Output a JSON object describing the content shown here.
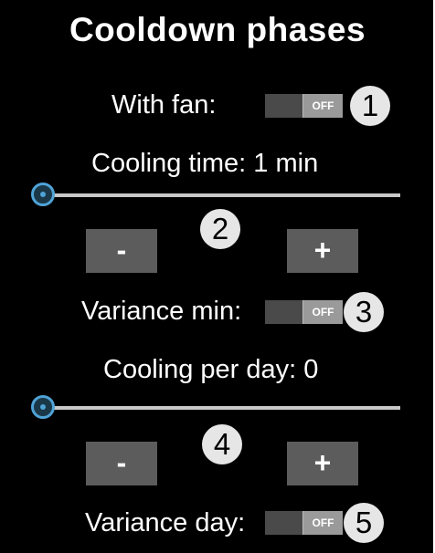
{
  "header": {
    "title": "Cooldown phases"
  },
  "with_fan": {
    "label": "With fan:",
    "toggle_text": "OFF",
    "badge": "1"
  },
  "cooling_time": {
    "label": "Cooling time: 1 min",
    "slider_value": 0,
    "badge": "2",
    "minus_label": "-",
    "plus_label": "+"
  },
  "variance_min": {
    "label": "Variance min:",
    "toggle_text": "OFF",
    "badge": "3"
  },
  "cooling_per_day": {
    "label": "Cooling per day: 0",
    "slider_value": 0,
    "badge": "4",
    "minus_label": "-",
    "plus_label": "+"
  },
  "variance_day": {
    "label": "Variance day:",
    "toggle_text": "OFF",
    "badge": "5"
  },
  "colors": {
    "background": "#000000",
    "slider_accent": "#4fa3d6",
    "button": "#5c5c5c",
    "badge": "#e6e6e6"
  }
}
